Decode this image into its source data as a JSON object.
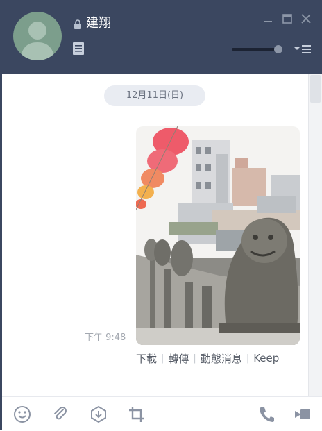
{
  "chat": {
    "title": "建翔",
    "date_label": "12月11日(日)",
    "message": {
      "time": "下午 9:48"
    },
    "actions": [
      "下載",
      "轉傳",
      "動態消息",
      "Keep"
    ]
  },
  "icons": {
    "header": [
      "lock-icon",
      "note-icon",
      "minimize-icon",
      "maximize-icon",
      "close-icon",
      "volume-slider",
      "menu-icon"
    ],
    "footer": [
      "emoji-icon",
      "attach-icon",
      "keep-icon",
      "crop-icon",
      "call-icon",
      "video-icon"
    ]
  },
  "colors": {
    "header_bg": "#3b4760",
    "accent": "#7c9e8c",
    "date_pill": "#e9ecf2"
  }
}
